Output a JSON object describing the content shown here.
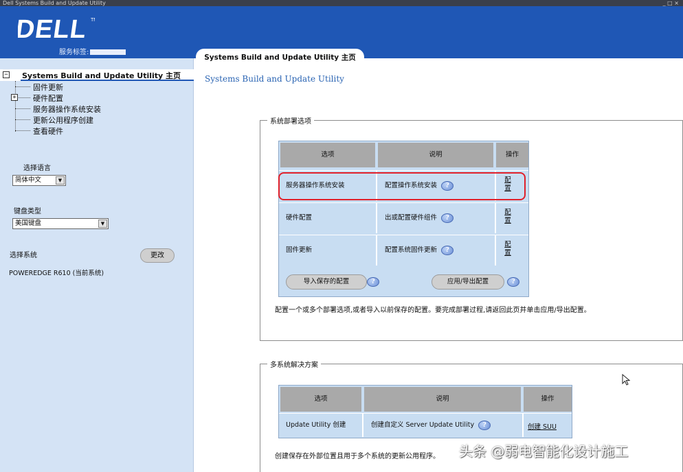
{
  "window": {
    "title": "Dell Systems Build and Update Utility",
    "controls": "_ □ ×"
  },
  "header": {
    "brand": "DELL",
    "service_tag_label": "服务标签:",
    "active_tab": "Systems Build and Update Utility 主页"
  },
  "sidebar": {
    "tree_root": "Systems Build and Update Utility 主页",
    "tree_items": [
      "固件更新",
      "硬件配置",
      "服务器操作系统安装",
      "更新公用程序创建",
      "查看硬件"
    ],
    "language_label": "选择语言",
    "language_value": "简体中文",
    "keyboard_label": "键盘类型",
    "keyboard_value": "美国键盘",
    "system_label": "选择系统",
    "change_button": "更改",
    "system_model": "POWEREDGE R610 (当前系统)"
  },
  "main": {
    "title": "Systems Build and Update Utility",
    "group1": {
      "legend": "系统部署选项",
      "headers": [
        "选项",
        "说明",
        "操作"
      ],
      "rows": [
        {
          "option": "服务器操作系统安装",
          "description": "配置操作系统安装",
          "action": "配置"
        },
        {
          "option": "硬件配置",
          "description": "出或配置硬件组件",
          "action": "配置"
        },
        {
          "option": "固件更新",
          "description": "配置系统固件更新",
          "action": "配置"
        }
      ],
      "import_button": "导入保存的配置",
      "apply_button": "应用/导出配置",
      "description": "配置一个或多个部署选项,或者导入以前保存的配置。要完成部署过程,请返回此页并单击应用/导出配置。"
    },
    "group2": {
      "legend": "多系统解决方案",
      "headers": [
        "选项",
        "说明",
        "操作"
      ],
      "rows": [
        {
          "option": "Update Utility 创建",
          "description": "创建自定义 Server Update Utility",
          "action": "创建 SUU"
        }
      ],
      "description": "创建保存在外部位置且用于多个系统的更新公用程序。"
    },
    "help_glyph": "?"
  },
  "watermark": "头条 @弱电智能化设计施工"
}
